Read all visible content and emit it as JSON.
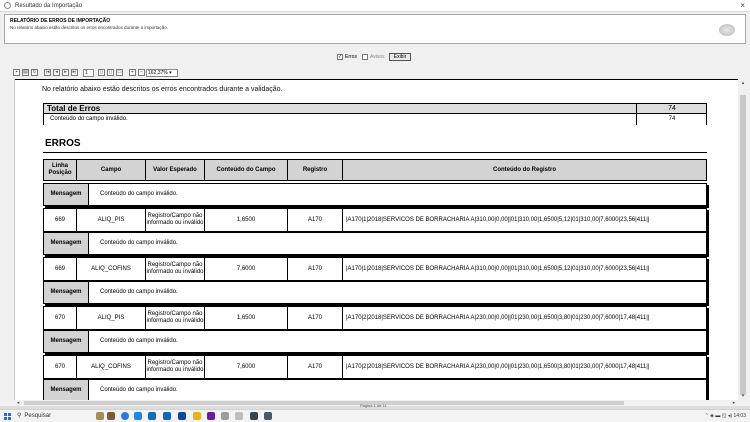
{
  "window": {
    "title": "Resultado da Importação",
    "close_glyph": "×"
  },
  "report_header": {
    "title": "RELATÓRIO DE ERROS DE IMPORTAÇÃO",
    "subtitle": "No relatório abaixo estão descritos os erros encontrados durante a importação."
  },
  "filters": {
    "erros_label": "Erros",
    "erros_checked": true,
    "avisos_label": "Avisos",
    "avisos_checked": false,
    "exibir_label": "Exibir"
  },
  "toolbar": {
    "page_value": "1",
    "zoom_value": "162,37%"
  },
  "report": {
    "intro": "No relatório abaixo estão descritos os erros encontrados durante a validação.",
    "total_label": "Total de Erros",
    "total_value": "74",
    "total_row_label": "Conteúdo do campo inválido.",
    "total_row_value": "74",
    "errors_title": "ERROS",
    "columns": [
      "Linha Posição",
      "Campo",
      "Valor Esperado",
      "Conteúdo do Campo",
      "Registro",
      "Conteúdo do Registro"
    ],
    "message_label": "Mensagem",
    "messages": [
      "Conteúdo do campo inválido.",
      "Conteúdo do campo inválido.",
      "Conteúdo do campo inválido.",
      "Conteúdo do campo inválido.",
      "Conteúdo do campo inválido."
    ],
    "rows": [
      {
        "linha": "669",
        "campo": "ALIQ_PIS",
        "esperado": "Registro/Campo não informado ou inválido",
        "conteudo": "1,6500",
        "registro": "A170",
        "conteudo_registro": "|A170|1|2018|SERVICOS DE BORRACHARIA A|310,00|0,00||01|310,00|1,6500|5,12|01|310,00|7,6000|23,56|411||"
      },
      {
        "linha": "669",
        "campo": "ALIQ_COFINS",
        "esperado": "Registro/Campo não informado ou inválido",
        "conteudo": "7,6000",
        "registro": "A170",
        "conteudo_registro": "|A170|1|2018|SERVICOS DE BORRACHARIA A|310,00|0,00||01|310,00|1,6500|5,12|01|310,00|7,6000|23,56|411||"
      },
      {
        "linha": "670",
        "campo": "ALIQ_PIS",
        "esperado": "Registro/Campo não informado ou inválido",
        "conteudo": "1,6500",
        "registro": "A170",
        "conteudo_registro": "|A170|2|2018|SERVICOS DE BORRACHARIA A|230,00|0,00||01|230,00|1,6500|3,80|01|230,00|7,6000|17,48|411||"
      },
      {
        "linha": "670",
        "campo": "ALIQ_COFINS",
        "esperado": "Registro/Campo não informado ou inválido",
        "conteudo": "7,6000",
        "registro": "A170",
        "conteudo_registro": "|A170|2|2018|SERVICOS DE BORRACHARIA A|230,00|0,00||01|230,00|1,6500|3,80|01|230,00|7,6000|17,48|411||"
      }
    ]
  },
  "footer": {
    "page_indicator": "Página 1 de 11"
  },
  "taskbar": {
    "search_placeholder": "Pesquisar",
    "time": "14:03"
  },
  "colors": {
    "header_gray": "#d3d3d3",
    "windows_blue": "#1f6fd1"
  }
}
